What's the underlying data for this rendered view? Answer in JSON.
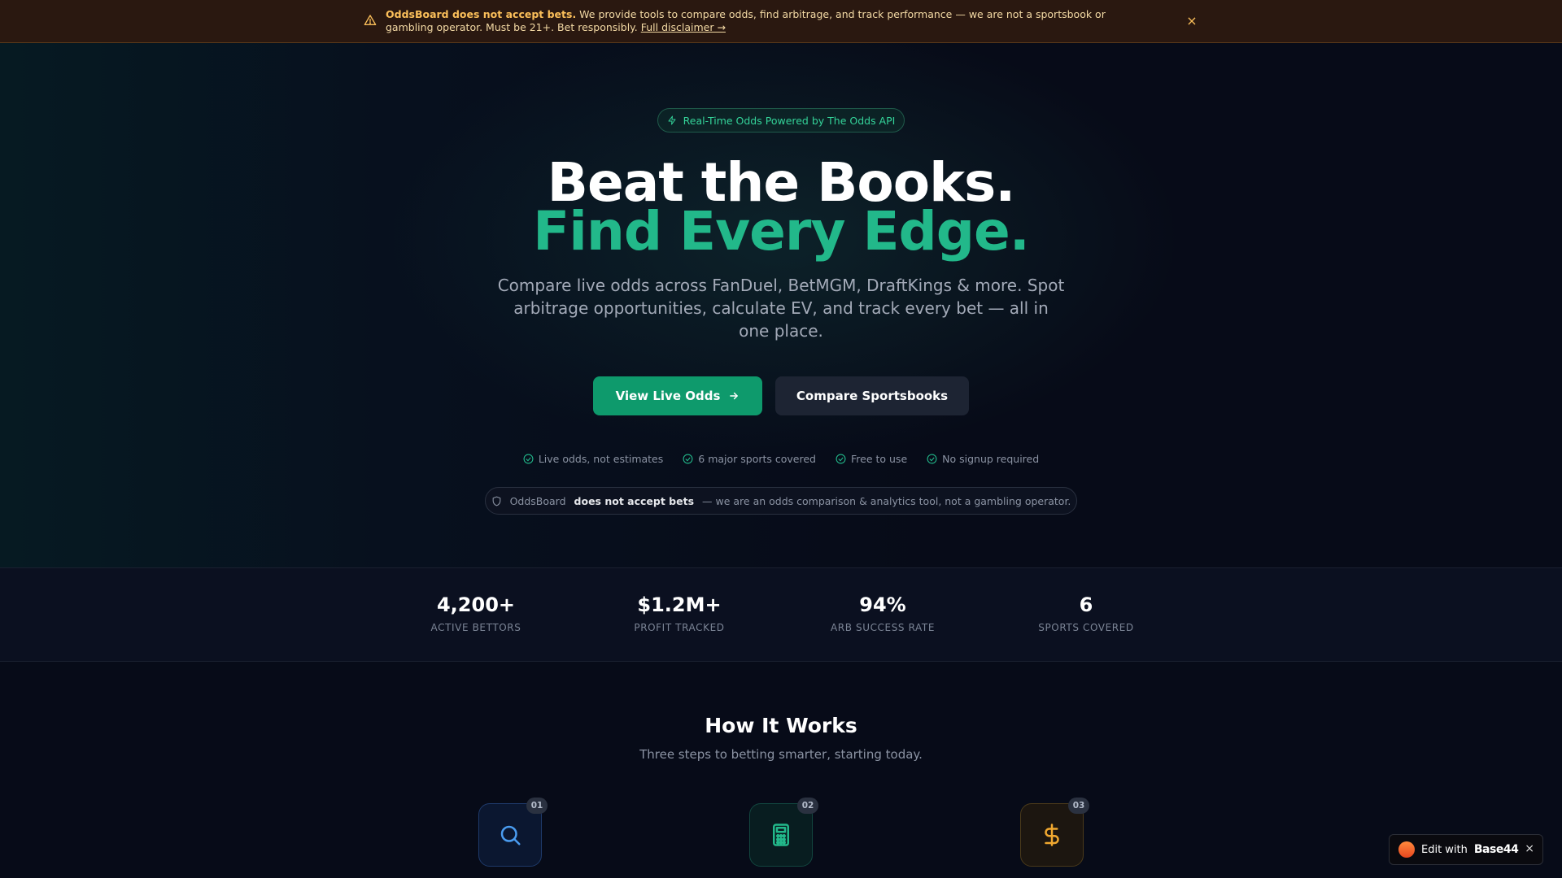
{
  "banner": {
    "bold": "OddsBoard does not accept bets.",
    "text": " We provide tools to compare odds, find arbitrage, and track performance — we are not a sportsbook or gambling operator. Must be 21+. Bet responsibly. ",
    "link": "Full disclaimer →",
    "close": "×"
  },
  "hero": {
    "pill": "Real-Time Odds Powered by The Odds API",
    "title_line1": "Beat the Books.",
    "title_line2": "Find Every Edge.",
    "subtitle": "Compare live odds across FanDuel, BetMGM, DraftKings & more. Spot arbitrage opportunities, calculate EV, and track every bet — all in one place.",
    "primary_button": "View Live Odds",
    "secondary_button": "Compare Sportsbooks",
    "checks": [
      "Live odds, not estimates",
      "6 major sports covered",
      "Free to use",
      "No signup required"
    ],
    "notice_brand": "OddsBoard",
    "notice_bold": "does not accept bets",
    "notice_text": "— we are an odds comparison & analytics tool, not a gambling operator."
  },
  "stats": [
    {
      "value": "4,200+",
      "label": "ACTIVE BETTORS"
    },
    {
      "value": "$1.2M+",
      "label": "PROFIT TRACKED"
    },
    {
      "value": "94%",
      "label": "ARB SUCCESS RATE"
    },
    {
      "value": "6",
      "label": "SPORTS COVERED"
    }
  ],
  "how": {
    "title": "How It Works",
    "subtitle": "Three steps to betting smarter, starting today.",
    "steps": [
      {
        "num": "01",
        "icon": "search-icon"
      },
      {
        "num": "02",
        "icon": "calculator-icon"
      },
      {
        "num": "03",
        "icon": "dollar-icon"
      }
    ]
  },
  "badge": {
    "prefix": "Edit with",
    "brand": "Base44",
    "close": "×"
  },
  "colors": {
    "accent": "#22b88a",
    "primary_button": "#0e9a6c",
    "banner_bg": "#2a1810",
    "warn": "#fbbf5a"
  }
}
